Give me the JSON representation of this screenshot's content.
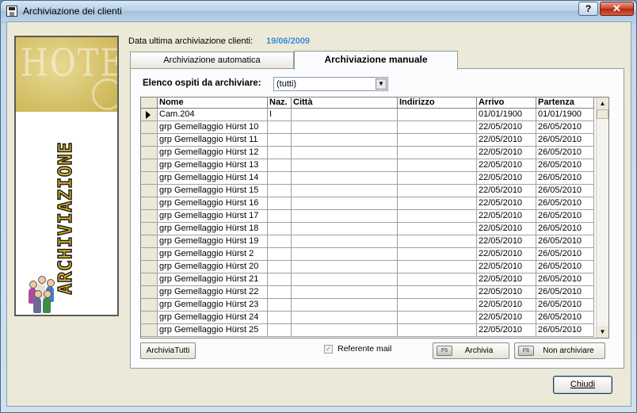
{
  "window": {
    "title": "Archiviazione dei clienti",
    "help_label": "?",
    "close_label": "✕"
  },
  "side_panel": {
    "banner_text": "HOTEL",
    "vertical_text": "ARCHIVIAZIONE"
  },
  "info": {
    "label": "Data ultima archiviazione clienti:",
    "value": "19/06/2009"
  },
  "tabs": [
    {
      "label": "Archiviazione automatica",
      "active": false
    },
    {
      "label": "Archiviazione manuale",
      "active": true
    }
  ],
  "filter": {
    "label": "Elenco ospiti da archiviare:",
    "value": "(tutti)"
  },
  "grid": {
    "columns": [
      "Nome",
      "Naz.",
      "Città",
      "Indirizzo",
      "Arrivo",
      "Partenza"
    ],
    "rows": [
      [
        "Cam.204",
        "I",
        "",
        "",
        "01/01/1900",
        "01/01/1900"
      ],
      [
        "grp Gemellaggio Hürst 10",
        "",
        "",
        "",
        "22/05/2010",
        "26/05/2010"
      ],
      [
        "grp Gemellaggio Hürst 11",
        "",
        "",
        "",
        "22/05/2010",
        "26/05/2010"
      ],
      [
        "grp Gemellaggio Hürst 12",
        "",
        "",
        "",
        "22/05/2010",
        "26/05/2010"
      ],
      [
        "grp Gemellaggio Hürst 13",
        "",
        "",
        "",
        "22/05/2010",
        "26/05/2010"
      ],
      [
        "grp Gemellaggio Hürst 14",
        "",
        "",
        "",
        "22/05/2010",
        "26/05/2010"
      ],
      [
        "grp Gemellaggio Hürst 15",
        "",
        "",
        "",
        "22/05/2010",
        "26/05/2010"
      ],
      [
        "grp Gemellaggio Hürst 16",
        "",
        "",
        "",
        "22/05/2010",
        "26/05/2010"
      ],
      [
        "grp Gemellaggio Hürst 17",
        "",
        "",
        "",
        "22/05/2010",
        "26/05/2010"
      ],
      [
        "grp Gemellaggio Hürst 18",
        "",
        "",
        "",
        "22/05/2010",
        "26/05/2010"
      ],
      [
        "grp Gemellaggio Hürst 19",
        "",
        "",
        "",
        "22/05/2010",
        "26/05/2010"
      ],
      [
        "grp Gemellaggio Hürst 2",
        "",
        "",
        "",
        "22/05/2010",
        "26/05/2010"
      ],
      [
        "grp Gemellaggio Hürst 20",
        "",
        "",
        "",
        "22/05/2010",
        "26/05/2010"
      ],
      [
        "grp Gemellaggio Hürst 21",
        "",
        "",
        "",
        "22/05/2010",
        "26/05/2010"
      ],
      [
        "grp Gemellaggio Hürst 22",
        "",
        "",
        "",
        "22/05/2010",
        "26/05/2010"
      ],
      [
        "grp Gemellaggio Hürst 23",
        "",
        "",
        "",
        "22/05/2010",
        "26/05/2010"
      ],
      [
        "grp Gemellaggio Hürst 24",
        "",
        "",
        "",
        "22/05/2010",
        "26/05/2010"
      ],
      [
        "grp Gemellaggio Hürst 25",
        "",
        "",
        "",
        "22/05/2010",
        "26/05/2010"
      ]
    ]
  },
  "buttons": {
    "archive_all": "ArchiviaTutti",
    "referent_mail": "Referente mail",
    "archive": "Archivia",
    "archive_key": "F5",
    "no_archive": "Non archiviare",
    "no_archive_key": "F6",
    "close": "Chiudi"
  },
  "colors": {
    "accent_date": "#3a8ed6",
    "vertical_text": "#f2c21a"
  }
}
